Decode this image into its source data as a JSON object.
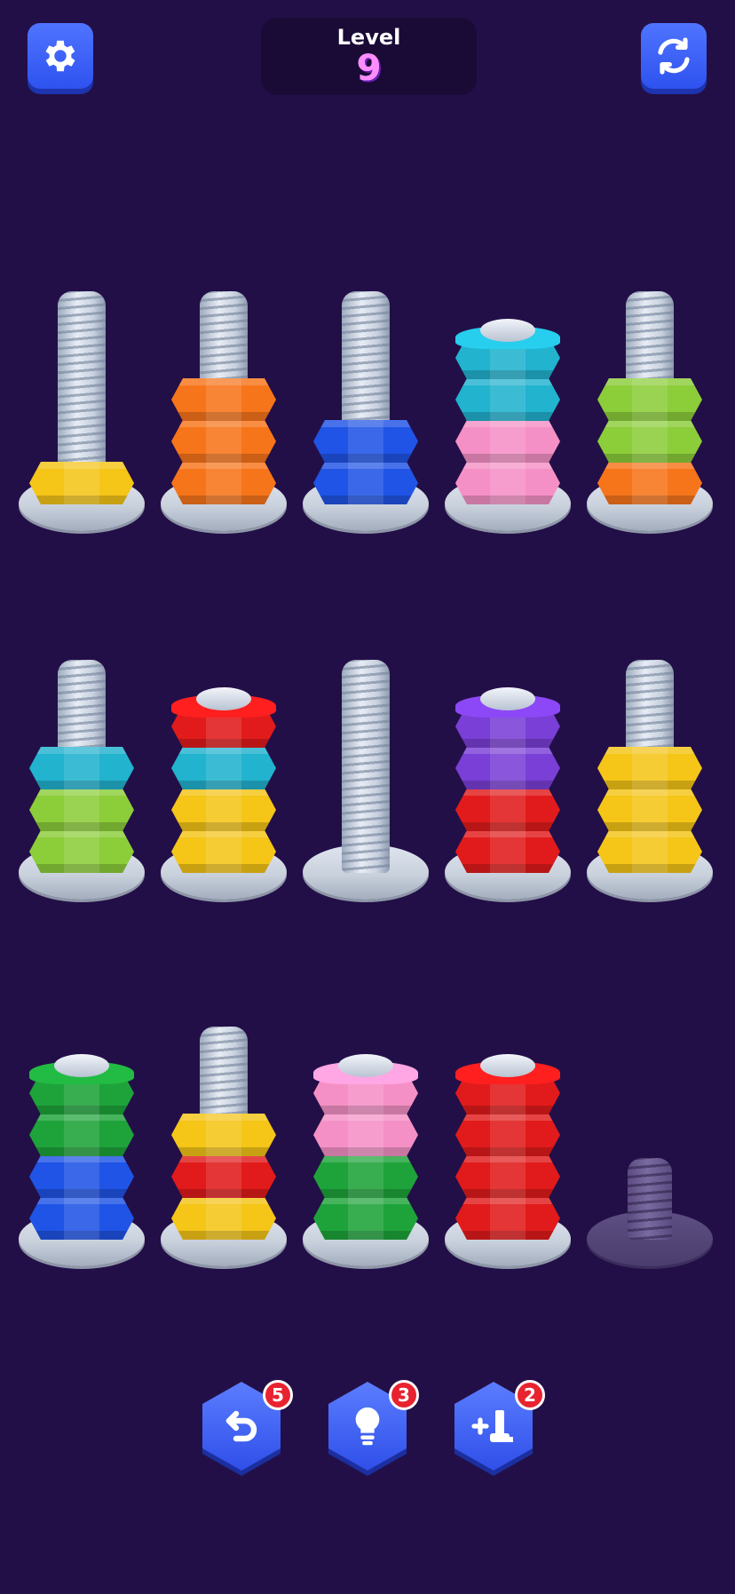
{
  "header": {
    "level_label": "Level",
    "level_number": "9",
    "settings_icon": "gear-icon",
    "restart_icon": "refresh-icon"
  },
  "colors": {
    "yellow": "#f5c518",
    "orange": "#f7751a",
    "blue": "#1f54e6",
    "cyan": "#22b3cf",
    "pink": "#f590c6",
    "lightgreen": "#8ccd3a",
    "red": "#e11b1b",
    "purple": "#7a3fd6",
    "green": "#1ea33a"
  },
  "board": {
    "rows": [
      {
        "poles": [
          {
            "nuts": [
              "yellow"
            ],
            "cap": false
          },
          {
            "nuts": [
              "orange",
              "orange",
              "orange"
            ],
            "cap": false
          },
          {
            "nuts": [
              "blue",
              "blue"
            ],
            "cap": false
          },
          {
            "nuts": [
              "pink",
              "pink",
              "cyan",
              "cyan"
            ],
            "cap": true
          },
          {
            "nuts": [
              "orange",
              "lightgreen",
              "lightgreen"
            ],
            "cap": false
          }
        ]
      },
      {
        "poles": [
          {
            "nuts": [
              "lightgreen",
              "lightgreen",
              "cyan"
            ],
            "cap": false
          },
          {
            "nuts": [
              "yellow",
              "yellow",
              "cyan",
              "red"
            ],
            "cap": true
          },
          {
            "nuts": [],
            "cap": false
          },
          {
            "nuts": [
              "red",
              "red",
              "purple",
              "purple"
            ],
            "cap": true
          },
          {
            "nuts": [
              "yellow",
              "yellow",
              "yellow"
            ],
            "cap": false
          }
        ]
      },
      {
        "poles": [
          {
            "nuts": [
              "blue",
              "blue",
              "green",
              "green"
            ],
            "cap": true
          },
          {
            "nuts": [
              "yellow",
              "red",
              "yellow"
            ],
            "cap": false
          },
          {
            "nuts": [
              "green",
              "green",
              "pink",
              "pink"
            ],
            "cap": true
          },
          {
            "nuts": [
              "red",
              "red",
              "red",
              "red"
            ],
            "cap": true
          },
          {
            "nuts": [],
            "cap": false,
            "locked": true
          }
        ]
      }
    ]
  },
  "powerups": [
    {
      "name": "undo",
      "icon": "undo-arrow-icon",
      "count": "5"
    },
    {
      "name": "hint",
      "icon": "lightbulb-icon",
      "count": "3"
    },
    {
      "name": "add-bolt",
      "icon": "add-bolt-icon",
      "count": "2"
    }
  ]
}
